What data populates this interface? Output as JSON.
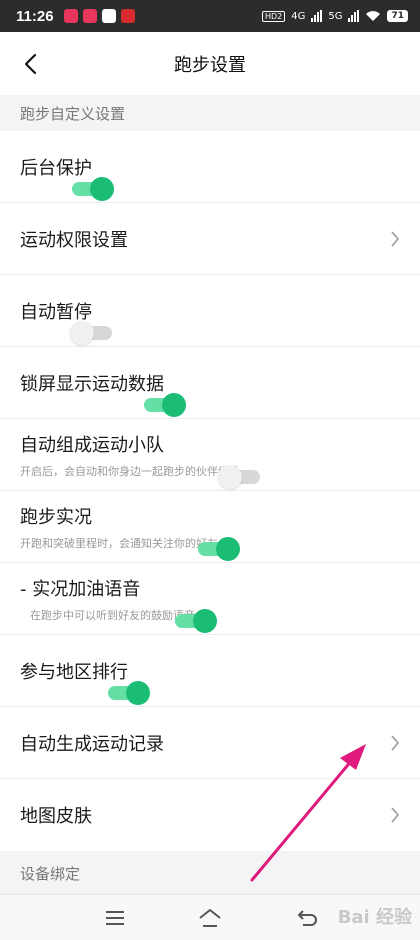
{
  "status_bar": {
    "time": "11:26",
    "network": [
      "HD2",
      "4G",
      "5G"
    ],
    "battery": "71"
  },
  "header": {
    "title": "跑步设置"
  },
  "sections": [
    {
      "title": "跑步自定义设置"
    },
    {
      "title": "设备绑定"
    }
  ],
  "settings": [
    {
      "label": "后台保护",
      "control": "toggle",
      "on": true
    },
    {
      "label": "运动权限设置",
      "control": "chevron"
    },
    {
      "label": "自动暂停",
      "control": "toggle",
      "on": false
    },
    {
      "label": "锁屏显示运动数据",
      "control": "toggle",
      "on": true
    },
    {
      "label": "自动组成运动小队",
      "sub": "开启后，会自动和你身边一起跑步的伙伴组队",
      "control": "toggle",
      "on": false
    },
    {
      "label": "跑步实况",
      "sub": "开跑和突破里程时，会通知关注你的好友",
      "control": "toggle",
      "on": true
    },
    {
      "label": "- 实况加油语音",
      "sub": "在跑步中可以听到好友的鼓励语音",
      "control": "toggle",
      "on": true
    },
    {
      "label": "参与地区排行",
      "control": "toggle",
      "on": true
    },
    {
      "label": "自动生成运动记录",
      "control": "chevron"
    },
    {
      "label": "地图皮肤",
      "control": "chevron"
    }
  ],
  "watermark": "Bai 经验",
  "colors": {
    "toggle_on_track": "#64dfa6",
    "toggle_on_knob": "#1bbd75",
    "toggle_off_track": "#d7d7d7",
    "annotation_arrow": "#e0197d"
  }
}
